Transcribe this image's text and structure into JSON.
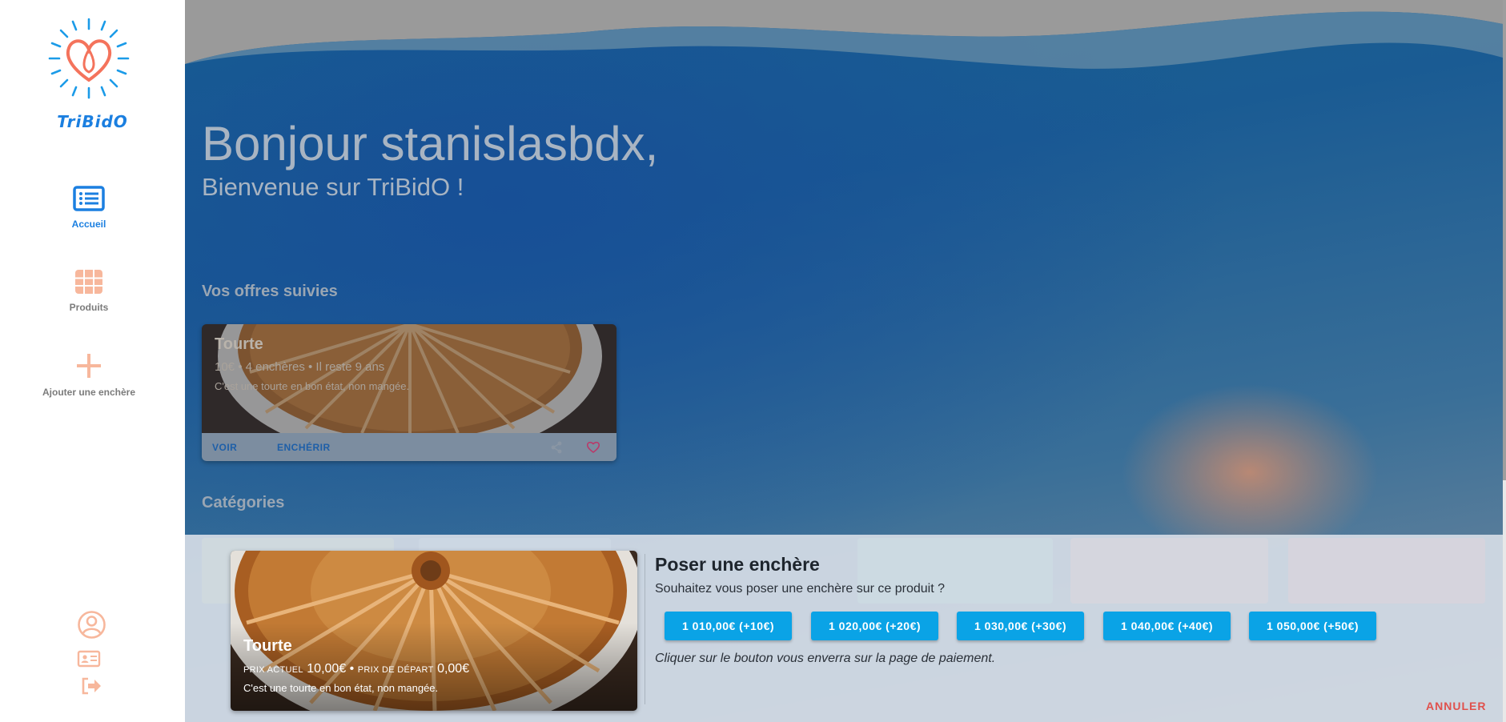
{
  "app": {
    "logo_text": "TriBidO"
  },
  "sidebar": {
    "items": [
      {
        "label": "Accueil",
        "icon": "list-icon",
        "active": true
      },
      {
        "label": "Produits",
        "icon": "grid-icon",
        "active": false
      },
      {
        "label": "Ajouter une enchère",
        "icon": "plus-icon",
        "active": false
      }
    ],
    "bottom_icons": [
      "account-circle-icon",
      "id-card-icon",
      "logout-icon"
    ]
  },
  "main": {
    "greeting": "Bonjour stanislasbdx,",
    "welcome": "Bienvenue sur TriBidO !",
    "followed_title": "Vos offres suivies",
    "categories_title": "Catégories",
    "offer_card": {
      "title": "Tourte",
      "meta": "10€ • 4 enchères • Il reste 9 ans",
      "description": "C'est une tourte en bon état, non mangée.",
      "view_label": "VOIR",
      "bid_label": "ENCHÉRIR",
      "favorite": true
    }
  },
  "bid_sheet": {
    "product_title": "Tourte",
    "current_price_label": "PRIX ACTUEL",
    "current_price": "10,00€",
    "start_price_label": "PRIX DE DÉPART",
    "start_price": "0,00€",
    "product_description": "C'est une tourte en bon état, non mangée.",
    "title": "Poser une enchère",
    "question": "Souhaitez vous poser une enchère sur ce produit ?",
    "bid_options": [
      "1 010,00€ (+10€)",
      "1 020,00€ (+20€)",
      "1 030,00€ (+30€)",
      "1 040,00€ (+40€)",
      "1 050,00€ (+50€)"
    ],
    "note": "Cliquer sur le bouton vous enverra sur la page de paiement.",
    "cancel_label": "ANNULER"
  },
  "colors": {
    "brand_blue": "#1b7fe0",
    "brand_coral": "#f4735c",
    "bid_button": "#0aa3e6",
    "cancel": "#e0514d"
  }
}
